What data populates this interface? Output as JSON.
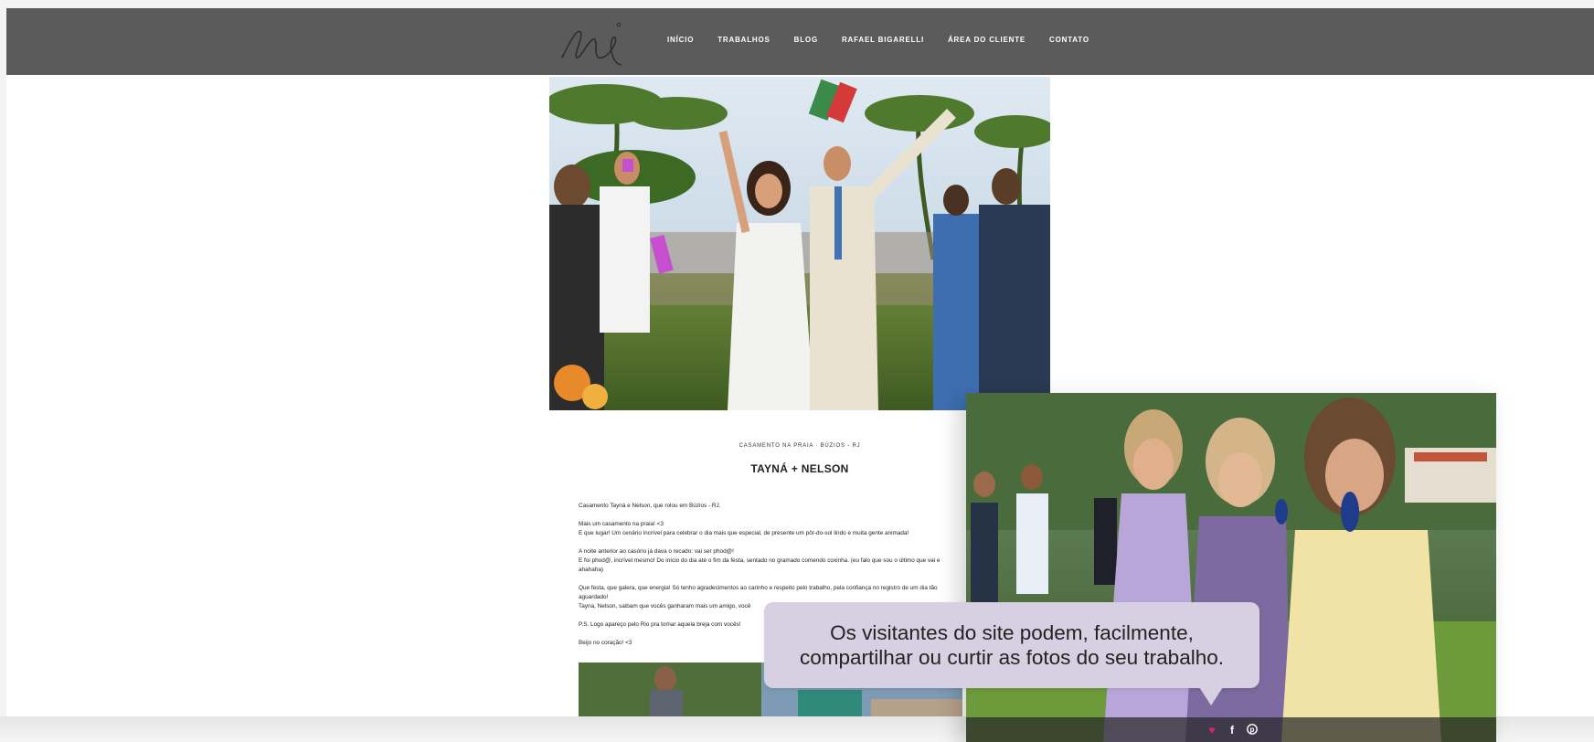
{
  "header": {
    "logo_icon": "signature-logo",
    "nav": [
      "INÍCIO",
      "TRABALHOS",
      "BLOG",
      "RAFAEL BIGARELLI",
      "ÁREA DO CLIENTE",
      "CONTATO"
    ]
  },
  "hero": {
    "image": "wedding-couple-beach-ceremony-photo"
  },
  "post": {
    "kicker": "CASAMENTO NA PRAIA  ·  BÚZIOS - RJ",
    "title": "TAYNÁ + NELSON",
    "paragraphs": [
      "Casamento Tayná e Nelson, que rolou em Búzios - RJ.",
      "Mais um casamento na praia! <3",
      "E que lugar! Um cenário incrível para celebrar o dia mais que especial, de presente um pôr-do-sol lindo e muita gente animada!",
      "A noite anterior ao casório já dava o recado: vai ser phod@!",
      "E foi phod@, incrível mesmo! Do início do dia até o fim da festa, sentado no gramado comendo coxinha. (eu falo que sou o último que vai e",
      "ahahaha)",
      "Que festa, que galera, que energia!  Só tenho agradecimentos ao carinho e respeito pelo trabalho, pela confiança no registro de um dia tão",
      "aguardado!",
      "Tayna, Nelson, saibam que vocês ganharam mais um amigo, você",
      "P.S. Logo apareço pelo Rio pra tomar aquela breja com vocês!",
      "Beijo no coração! <3"
    ]
  },
  "overlay": {
    "image": "bridesmaids-garden-photo",
    "share_icons": [
      "heart-icon",
      "facebook-icon",
      "pinterest-icon"
    ]
  },
  "tooltip": {
    "text": "Os visitantes do site podem, facilmente, compartilhar ou curtir as fotos do seu trabalho."
  },
  "colors": {
    "header_bg": "#5b5b5b",
    "tooltip_bg": "#d7d0e3",
    "heart": "#e0245e"
  }
}
